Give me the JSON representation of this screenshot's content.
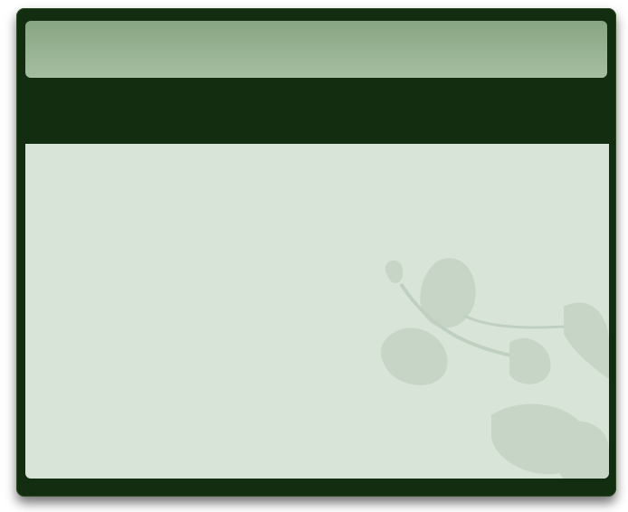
{
  "window": {
    "title": ""
  },
  "content": {
    "background_art": "lotus-watermark"
  },
  "colors": {
    "frame": "#132d11",
    "header_top": "#88a583",
    "header_bottom": "#a5bea0",
    "content_bg": "#d8e4d8"
  }
}
